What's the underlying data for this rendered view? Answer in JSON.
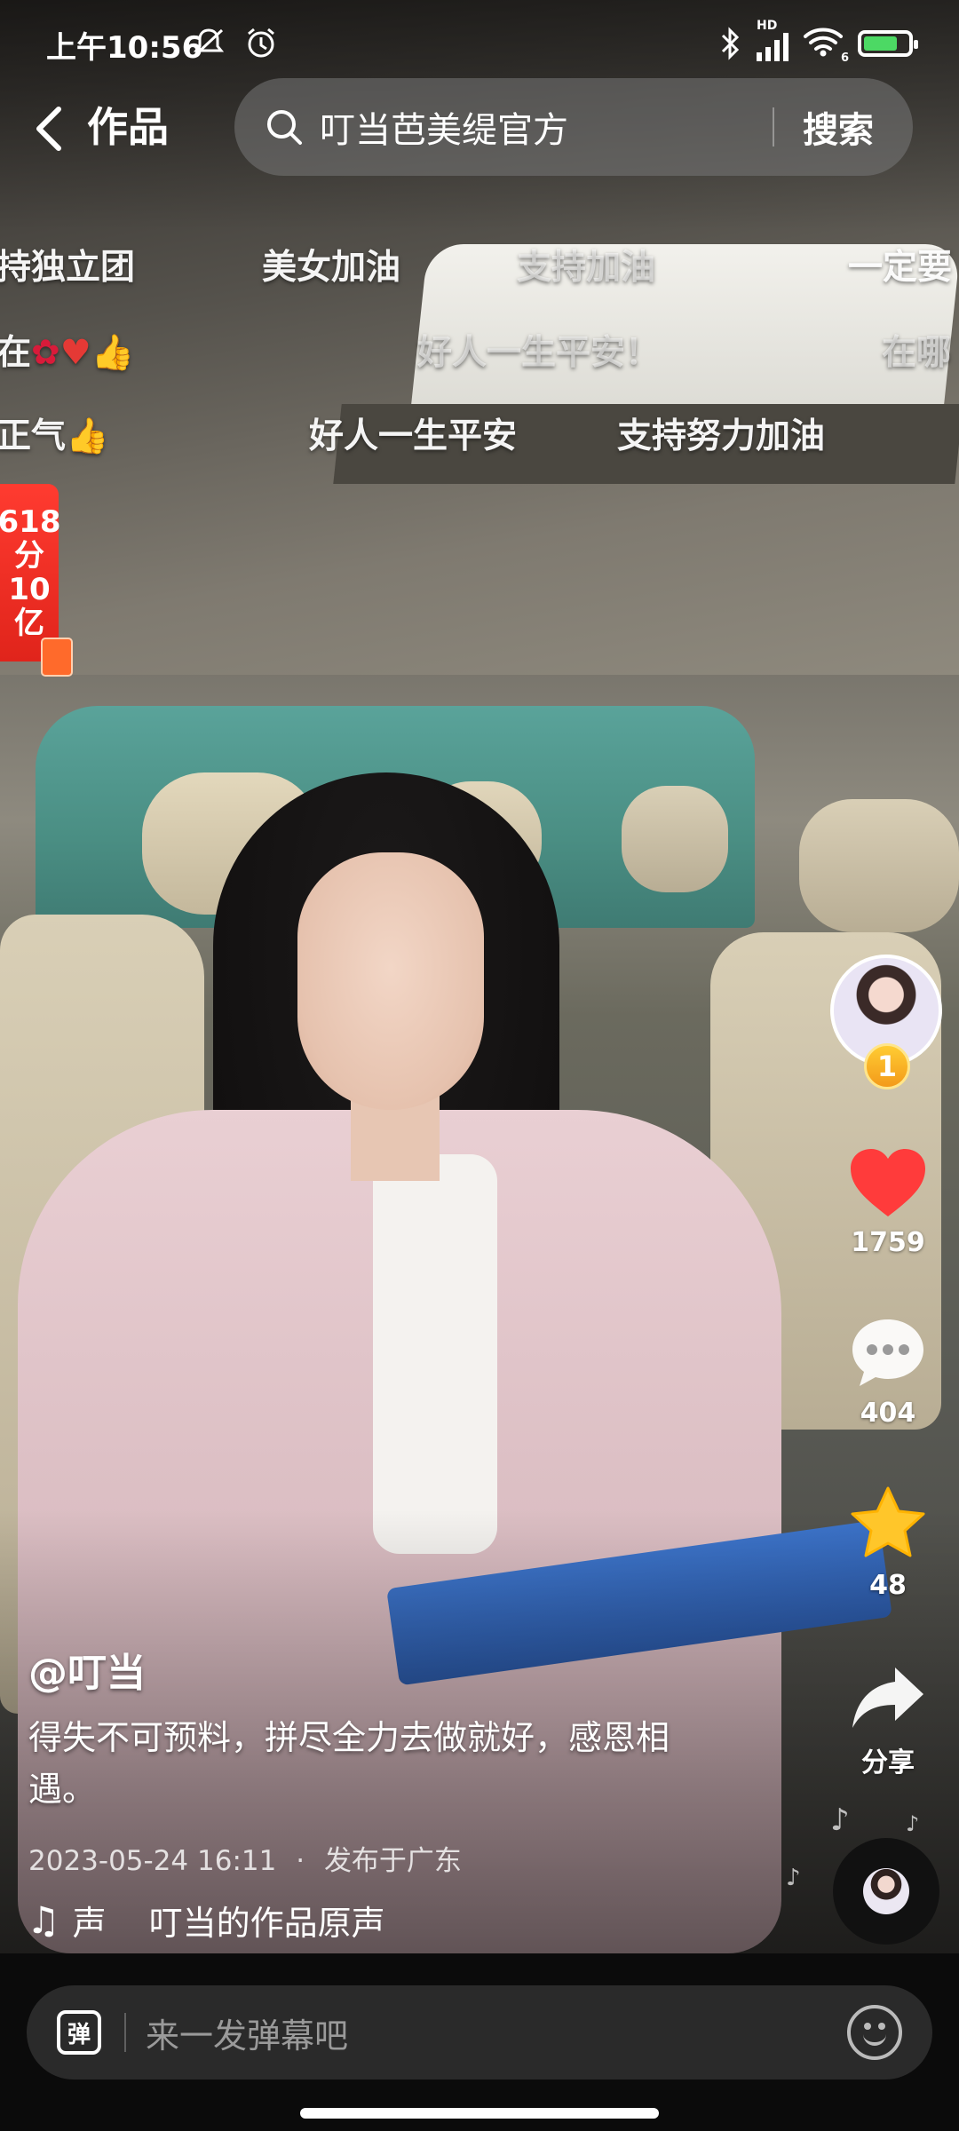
{
  "status_bar": {
    "time": "上午10:56",
    "left_icons": [
      "mute-icon",
      "alarm-icon"
    ],
    "right_icons": [
      "bluetooth-icon",
      "hd-signal-icon",
      "wifi-icon",
      "battery-icon"
    ],
    "hd_label": "HD",
    "wifi_sub": "6",
    "battery_level": 0.8
  },
  "header": {
    "title": "作品",
    "search_query": "叮当芭美缇官方",
    "search_button": "搜索"
  },
  "danmaku": [
    {
      "text": "持独立团",
      "faded": false
    },
    {
      "text": "美女加油",
      "faded": false
    },
    {
      "text": "支持加油",
      "faded": true
    },
    {
      "text": "一定要",
      "faded": false
    },
    {
      "text": "在",
      "faded": false
    },
    {
      "text": "好人一生平安！",
      "faded": true
    },
    {
      "text": "在哪",
      "faded": true
    },
    {
      "text": "正气",
      "faded": false
    },
    {
      "text": "好人一生平安",
      "faded": false
    },
    {
      "text": "支持努力加油",
      "faded": false
    }
  ],
  "promo": {
    "line1": "618",
    "line2": "分",
    "line3": "10",
    "line4": "亿"
  },
  "actions": {
    "rank": "1",
    "likes": "1759",
    "comments": "404",
    "favorites": "48",
    "share_label": "分享"
  },
  "video_info": {
    "author": "@叮当",
    "caption": "得失不可预料，拼尽全力去做就好，感恩相遇。",
    "date": "2023-05-24 16:11",
    "separator": "·",
    "location": "发布于广东",
    "music_prefix": "声",
    "music_title": "叮当的作品原声",
    "progress": 0.22
  },
  "comment_bar": {
    "danmu_label": "弹",
    "placeholder": "来一发弹幕吧"
  },
  "colors": {
    "like": "#ff3b3b",
    "favorite": "#ffc62a",
    "promo": "#ff3b30"
  }
}
